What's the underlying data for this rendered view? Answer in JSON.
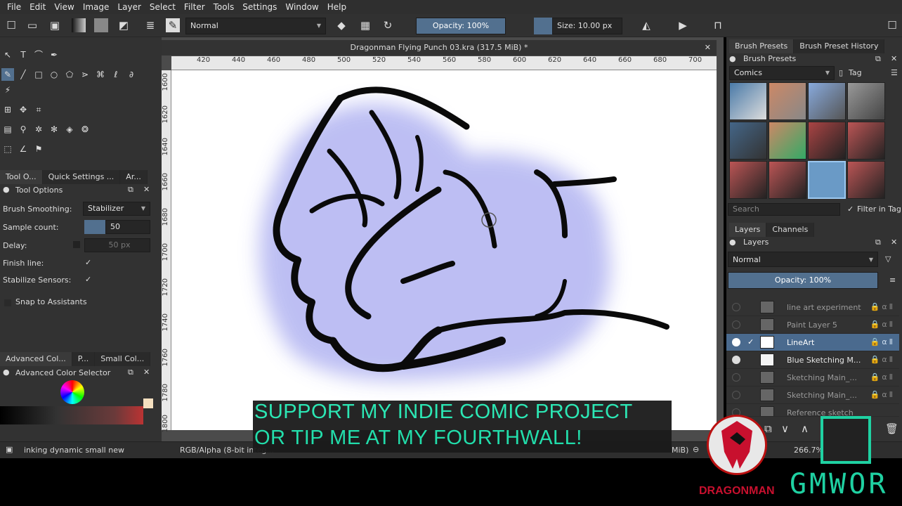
{
  "menubar": {
    "items": [
      "File",
      "Edit",
      "View",
      "Image",
      "Layer",
      "Select",
      "Filter",
      "Tools",
      "Settings",
      "Window",
      "Help"
    ]
  },
  "toolbar": {
    "blend_mode": "Normal",
    "opacity": "Opacity: 100%",
    "size": "Size: 10.00 px"
  },
  "document": {
    "title": "Dragonman Flying Punch 03.kra (317.5 MiB) *"
  },
  "ruler": {
    "top": [
      "420",
      "440",
      "460",
      "480",
      "500",
      "520",
      "540",
      "560",
      "580",
      "600",
      "620",
      "640",
      "660",
      "680",
      "700"
    ],
    "left": [
      "1600",
      "1620",
      "1640",
      "1660",
      "1680",
      "1700",
      "1720",
      "1740",
      "1760",
      "1780",
      "1800"
    ]
  },
  "left_panel": {
    "tabs": [
      "Tool O...",
      "Quick Settings ...",
      "Ar..."
    ],
    "tool_options_title": "Tool Options",
    "brush_smoothing_label": "Brush Smoothing:",
    "brush_smoothing_value": "Stabilizer",
    "sample_count_label": "Sample count:",
    "sample_count_value": "50",
    "delay_label": "Delay:",
    "delay_value": "50 px",
    "finish_line_label": "Finish line:",
    "stabilize_sensors_label": "Stabilize Sensors:",
    "snap_label": "Snap to Assistants",
    "color_tabs": [
      "Advanced Col...",
      "P...",
      "Small Col..."
    ],
    "color_selector_title": "Advanced Color Selector"
  },
  "right_panel": {
    "tabs": [
      "Brush Presets",
      "Brush Preset History"
    ],
    "presets_title": "Brush Presets",
    "preset_filter": "Comics",
    "tag_label": "Tag",
    "search_placeholder": "Search",
    "filter_in_tag": "Filter in Tag",
    "layer_tabs": [
      "Layers",
      "Channels"
    ],
    "layers_title": "Layers",
    "layer_blend": "Normal",
    "layer_opacity": "Opacity:  100%",
    "layers": [
      "line art experiment",
      "Paint Layer 5",
      "LineArt",
      "Blue Sketching M...",
      "Sketching Main_...",
      "Sketching Main_...",
      "Reference sketch"
    ]
  },
  "status": {
    "brush_name": "inking dynamic small new",
    "color_info": "RGB/Alpha (8-bit integ...",
    "mem": "MiB)",
    "zoom": "266.7%"
  },
  "overlay": {
    "line1": "SUPPORT MY INDIE COMIC PROJECT",
    "line2": "OR TIP ME AT MY FOURTHWALL!",
    "dragon_brand": "DRAGONMAN",
    "gmwor_brand": "GMWOR"
  }
}
